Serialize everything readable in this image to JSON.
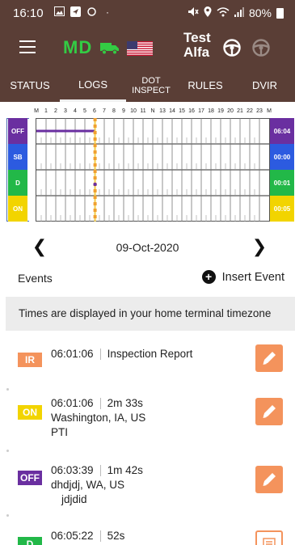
{
  "status_bar": {
    "time": "16:10",
    "battery": "80%"
  },
  "app_bar": {
    "state": "MD",
    "driver_name_line1": "Test",
    "driver_name_line2": "Alfa"
  },
  "tabs": [
    {
      "label": "STATUS",
      "active": false
    },
    {
      "label": "LOGS",
      "active": true
    },
    {
      "label": "DOT INSPECT",
      "active": false
    },
    {
      "label": "RULES",
      "active": false
    },
    {
      "label": "DVIR",
      "active": false
    }
  ],
  "log_grid": {
    "hour_labels": [
      "M",
      "1",
      "2",
      "3",
      "4",
      "5",
      "6",
      "7",
      "8",
      "9",
      "10",
      "11",
      "N",
      "13",
      "14",
      "15",
      "16",
      "17",
      "18",
      "19",
      "20",
      "21",
      "22",
      "23",
      "M"
    ],
    "statuses": [
      {
        "code": "OFF",
        "total": "06:04",
        "color": "#6a2fa0"
      },
      {
        "code": "SB",
        "total": "00:00",
        "color": "#2c5be0"
      },
      {
        "code": "D",
        "total": "00:01",
        "color": "#22b848"
      },
      {
        "code": "ON",
        "total": "00:05",
        "color": "#f2d400"
      }
    ],
    "current_hour": 6.05,
    "off_duty_hours": [
      0,
      6.05
    ]
  },
  "date_nav": {
    "date": "09-Oct-2020"
  },
  "events_header": {
    "title": "Events",
    "insert_label": "Insert Event"
  },
  "timezone_notice": "Times are displayed in your home terminal timezone",
  "events": [
    {
      "badge": "IR",
      "badge_color": "#f4935c",
      "time": "06:01:06",
      "detail": "Inspection Report",
      "location": "",
      "note": ""
    },
    {
      "badge": "ON",
      "badge_color": "#f2d400",
      "time": "06:01:06",
      "detail": "2m 33s",
      "location": "Washington, IA, US",
      "note": "PTI"
    },
    {
      "badge": "OFF",
      "badge_color": "#6a2fa0",
      "time": "06:03:39",
      "detail": "1m 42s",
      "location": "dhdjdj, WA, US",
      "note": "jdjdid"
    },
    {
      "badge": "D",
      "badge_color": "#22b848",
      "time": "06:05:22",
      "detail": "52s",
      "location": "",
      "note": ""
    }
  ]
}
